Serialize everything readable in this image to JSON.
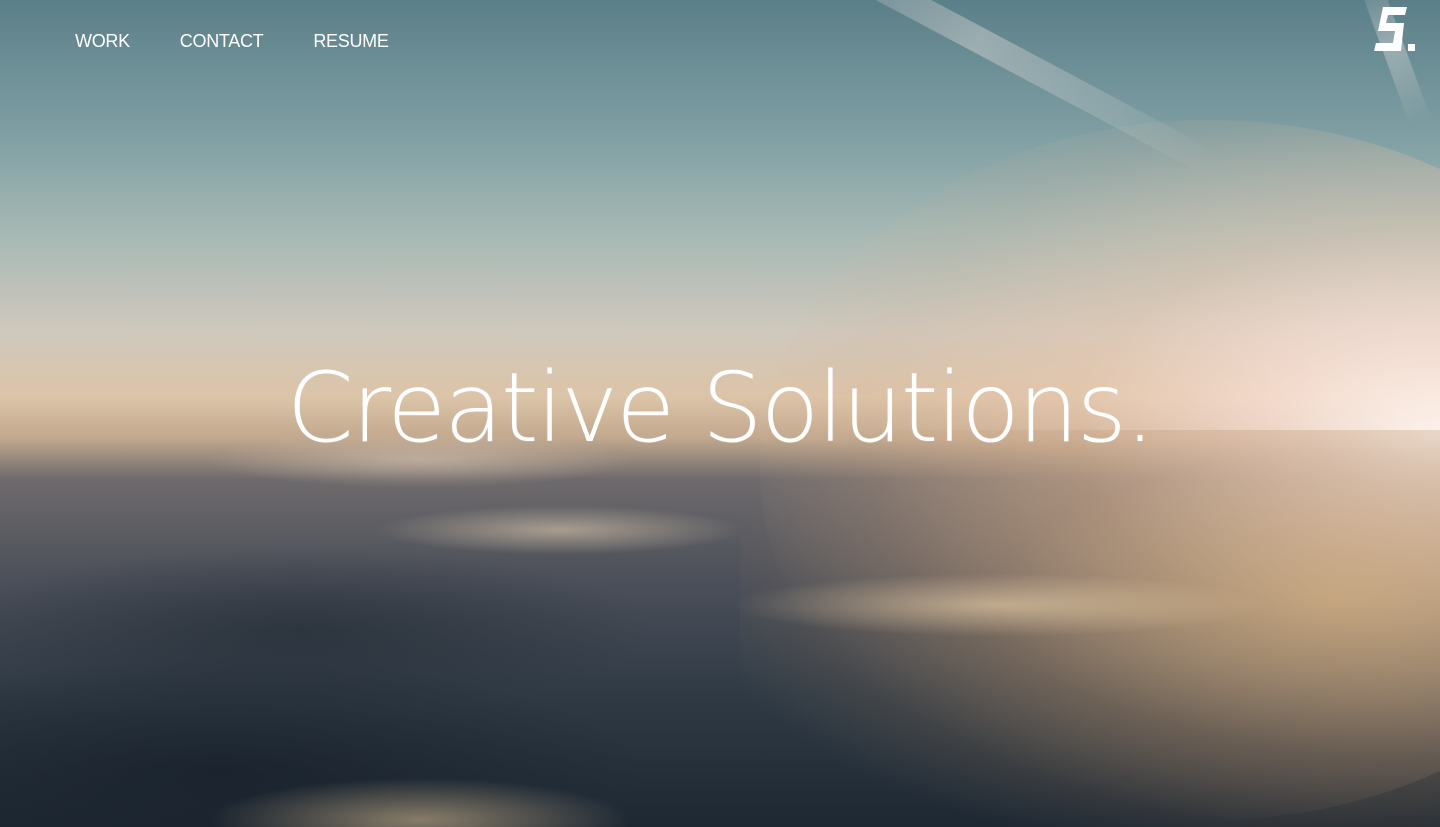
{
  "nav": {
    "items": [
      {
        "label": "WORK"
      },
      {
        "label": "CONTACT"
      },
      {
        "label": "RESUME"
      }
    ]
  },
  "logo": {
    "icon": "s-monogram-logo"
  },
  "hero": {
    "headline": "Creative Solutions.",
    "background": "sunset-above-clouds-photo"
  },
  "colors": {
    "text": "#ffffff",
    "sky_top": "#5b7f89",
    "horizon": "#dcc4a8",
    "clouds_dark": "#1e2833"
  }
}
